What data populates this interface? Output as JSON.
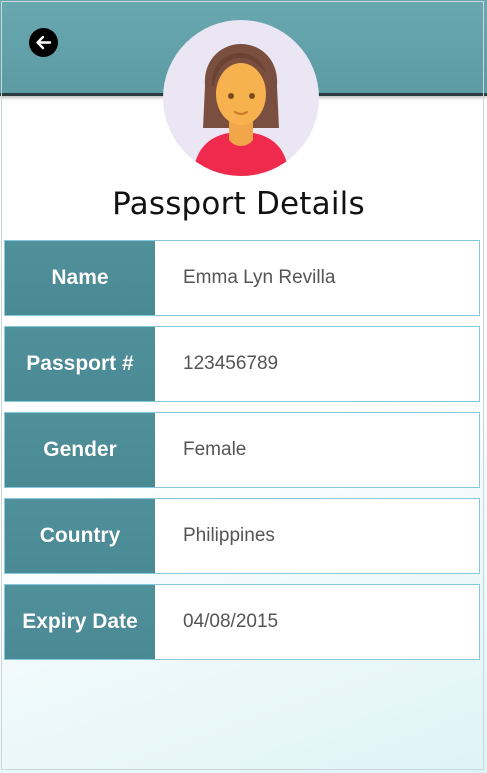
{
  "header": {
    "back_icon": "arrow-left-icon",
    "avatar_icon": "female-user-avatar-icon"
  },
  "page": {
    "title": "Passport Details"
  },
  "details": {
    "rows": [
      {
        "label": "Name",
        "value": "Emma Lyn Revilla"
      },
      {
        "label": "Passport #",
        "value": "123456789"
      },
      {
        "label": "Gender",
        "value": "Female"
      },
      {
        "label": "Country",
        "value": "Philippines"
      },
      {
        "label": "Expiry Date",
        "value": "04/08/2015"
      }
    ]
  },
  "colors": {
    "header": "#5d9ba4",
    "label_bg": "#4a8a95",
    "row_border": "#86c9dc",
    "value_text": "#555555"
  }
}
